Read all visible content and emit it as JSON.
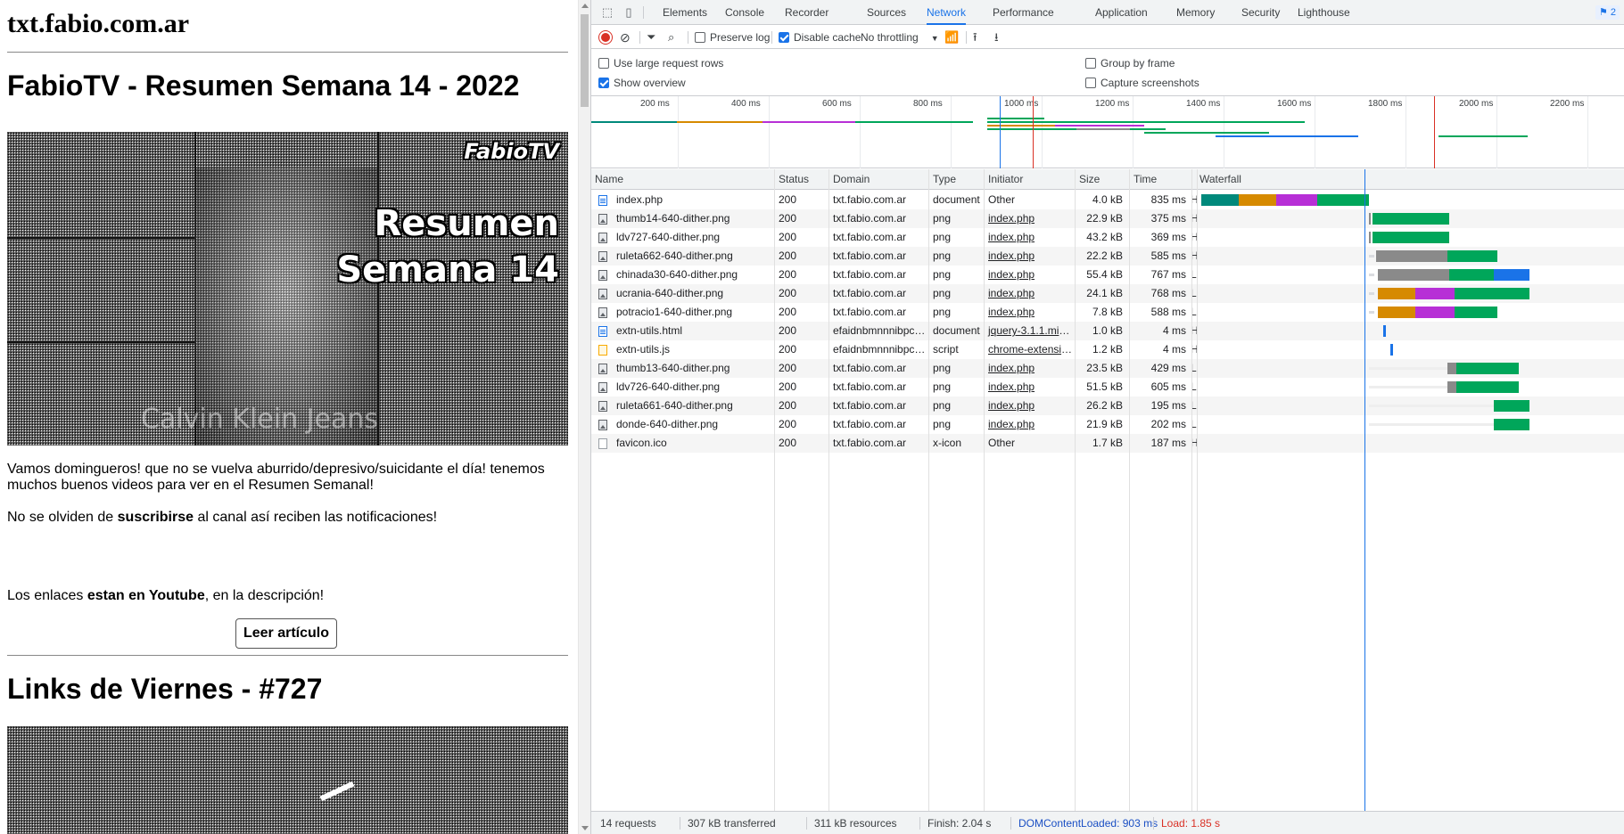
{
  "page": {
    "site_title": "txt.fabio.com.ar",
    "post1": {
      "title": "FabioTV - Resumen Semana 14 - 2022",
      "image_overlay_brand": "FabioTV",
      "image_overlay_line1": "Resumen",
      "image_overlay_line2": "Semana 14",
      "image_shirt_text": "Calvin Klein Jeans",
      "para1": "Vamos domingueros! que no se vuelva aburrido/depresivo/suicidante el día! tenemos muchos buenos videos para ver en el Resumen Semanal!",
      "para2_pre": "No se olviden de ",
      "para2_bold": "suscribirse",
      "para2_post": " al canal así reciben las notificaciones!",
      "para3_pre": "Los enlaces ",
      "para3_bold": "estan en Youtube",
      "para3_post": ", en la descripción!",
      "read_button": "Leer artículo"
    },
    "post2": {
      "title": "Links de Viernes - #727"
    }
  },
  "devtools": {
    "tabs": [
      "Elements",
      "Console",
      "Recorder",
      "Sources",
      "Network",
      "Performance",
      "Application",
      "Memory",
      "Security",
      "Lighthouse"
    ],
    "active_tab": "Network",
    "messages_badge": "2",
    "toolbar": {
      "preserve_log": "Preserve log",
      "disable_cache": "Disable cache",
      "throttling": "No throttling"
    },
    "settings": {
      "large_rows": "Use large request rows",
      "show_overview": "Show overview",
      "group_by_frame": "Group by frame",
      "capture_screenshots": "Capture screenshots"
    },
    "overview_ticks": [
      "200 ms",
      "400 ms",
      "600 ms",
      "800 ms",
      "1000 ms",
      "1200 ms",
      "1400 ms",
      "1600 ms",
      "1800 ms",
      "2000 ms",
      "2200 ms"
    ],
    "columns": {
      "name": "Name",
      "status": "Status",
      "domain": "Domain",
      "type": "Type",
      "initiator": "Initiator",
      "size": "Size",
      "time": "Time",
      "waterfall": "Waterfall"
    },
    "rows": [
      {
        "name": "index.php",
        "status": "200",
        "domain": "txt.fabio.com.ar",
        "type": "document",
        "initiator": "Other",
        "size": "4.0 kB",
        "time": "835 ms",
        "prio": "H",
        "icon": "doc"
      },
      {
        "name": "thumb14-640-dither.png",
        "status": "200",
        "domain": "txt.fabio.com.ar",
        "type": "png",
        "initiator": "index.php",
        "size": "22.9 kB",
        "time": "375 ms",
        "prio": "H",
        "icon": "img"
      },
      {
        "name": "ldv727-640-dither.png",
        "status": "200",
        "domain": "txt.fabio.com.ar",
        "type": "png",
        "initiator": "index.php",
        "size": "43.2 kB",
        "time": "369 ms",
        "prio": "H",
        "icon": "img"
      },
      {
        "name": "ruleta662-640-dither.png",
        "status": "200",
        "domain": "txt.fabio.com.ar",
        "type": "png",
        "initiator": "index.php",
        "size": "22.2 kB",
        "time": "585 ms",
        "prio": "H",
        "icon": "img"
      },
      {
        "name": "chinada30-640-dither.png",
        "status": "200",
        "domain": "txt.fabio.com.ar",
        "type": "png",
        "initiator": "index.php",
        "size": "55.4 kB",
        "time": "767 ms",
        "prio": "L",
        "icon": "img"
      },
      {
        "name": "ucrania-640-dither.png",
        "status": "200",
        "domain": "txt.fabio.com.ar",
        "type": "png",
        "initiator": "index.php",
        "size": "24.1 kB",
        "time": "768 ms",
        "prio": "L",
        "icon": "img"
      },
      {
        "name": "potracio1-640-dither.png",
        "status": "200",
        "domain": "txt.fabio.com.ar",
        "type": "png",
        "initiator": "index.php",
        "size": "7.8 kB",
        "time": "588 ms",
        "prio": "L",
        "icon": "img"
      },
      {
        "name": "extn-utils.html",
        "status": "200",
        "domain": "efaidnbmnnnibpcajp...",
        "type": "document",
        "initiator": "jquery-3.1.1.min.js:3",
        "size": "1.0 kB",
        "time": "4 ms",
        "prio": "H",
        "icon": "doc"
      },
      {
        "name": "extn-utils.js",
        "status": "200",
        "domain": "efaidnbmnnnibpcajp...",
        "type": "script",
        "initiator": "chrome-extension:...",
        "size": "1.2 kB",
        "time": "4 ms",
        "prio": "H",
        "icon": "script"
      },
      {
        "name": "thumb13-640-dither.png",
        "status": "200",
        "domain": "txt.fabio.com.ar",
        "type": "png",
        "initiator": "index.php",
        "size": "23.5 kB",
        "time": "429 ms",
        "prio": "L",
        "icon": "img"
      },
      {
        "name": "ldv726-640-dither.png",
        "status": "200",
        "domain": "txt.fabio.com.ar",
        "type": "png",
        "initiator": "index.php",
        "size": "51.5 kB",
        "time": "605 ms",
        "prio": "L",
        "icon": "img"
      },
      {
        "name": "ruleta661-640-dither.png",
        "status": "200",
        "domain": "txt.fabio.com.ar",
        "type": "png",
        "initiator": "index.php",
        "size": "26.2 kB",
        "time": "195 ms",
        "prio": "L",
        "icon": "img"
      },
      {
        "name": "donde-640-dither.png",
        "status": "200",
        "domain": "txt.fabio.com.ar",
        "type": "png",
        "initiator": "index.php",
        "size": "21.9 kB",
        "time": "202 ms",
        "prio": "L",
        "icon": "img"
      },
      {
        "name": "favicon.ico",
        "status": "200",
        "domain": "txt.fabio.com.ar",
        "type": "x-icon",
        "initiator": "Other",
        "size": "1.7 kB",
        "time": "187 ms",
        "prio": "H",
        "icon": "icon"
      }
    ],
    "statusbar": {
      "requests": "14 requests",
      "transferred": "307 kB transferred",
      "resources": "311 kB resources",
      "finish": "Finish: 2.04 s",
      "dcl": "DOMContentLoaded: 903 ms",
      "load": "Load: 1.85 s"
    },
    "colors": {
      "accent": "#1a73e8",
      "waiting": "#00a65a",
      "connect": "#d68a00",
      "ssl": "#b72fd6",
      "queue": "#8a8a8a",
      "dcl_line": "#1a73e8",
      "load_line": "#d93025",
      "load_text": "#d93025",
      "dcl_text": "#1a4fc4"
    }
  }
}
